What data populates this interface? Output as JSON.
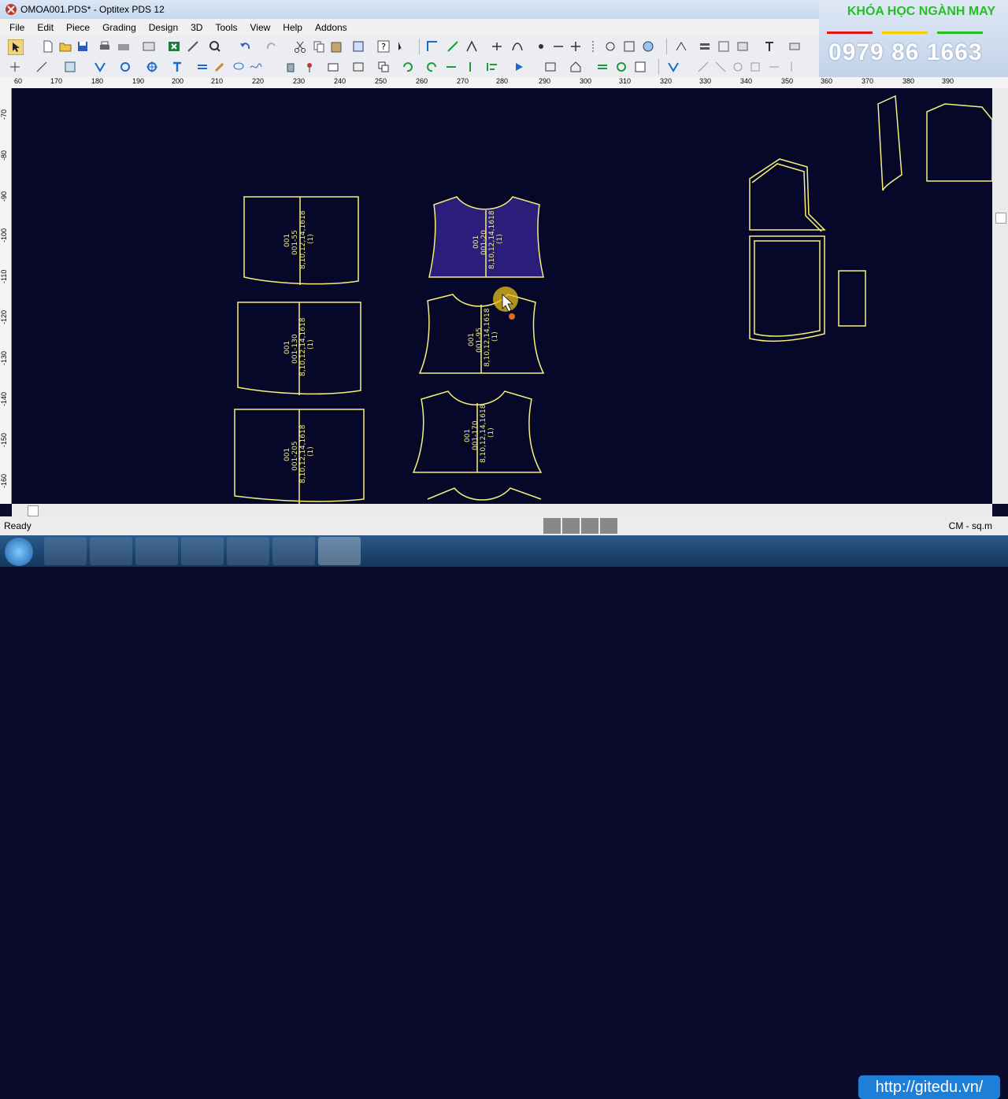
{
  "window": {
    "title": "OMOA001.PDS* - Optitex PDS 12"
  },
  "menu": [
    "File",
    "Edit",
    "Piece",
    "Grading",
    "Design",
    "3D",
    "Tools",
    "View",
    "Help",
    "Addons"
  ],
  "promo": {
    "course": "KHÓA HỌC NGÀNH MAY",
    "phone": "0979 86 1663",
    "colors": {
      "red": "#e01515",
      "yellow": "#f1d000",
      "green": "#1fbf1f"
    }
  },
  "ruler_h": [
    "60",
    "170",
    "180",
    "190",
    "200",
    "210",
    "220",
    "230",
    "240",
    "250",
    "260",
    "270",
    "280",
    "290",
    "300",
    "310",
    "320",
    "330",
    "340",
    "350",
    "360",
    "370",
    "380",
    "390"
  ],
  "ruler_v": [
    "-70",
    "-80",
    "-90",
    "-100",
    "-110",
    "-120",
    "-130",
    "-140",
    "-150",
    "-160"
  ],
  "pieces": [
    {
      "id": "rect-1",
      "label": "001\n001-55\n8,10,12,14,1618\n(1)"
    },
    {
      "id": "bodice-1",
      "label": "001\n001-20\n8,10,12,14,1618\n(1)"
    },
    {
      "id": "rect-2",
      "label": "001\n001-130\n8,10,12,14,1618\n(1)"
    },
    {
      "id": "bodice-2",
      "label": "001\n001-95\n8,10,12,14,1618\n(1)"
    },
    {
      "id": "rect-3",
      "label": "001\n001-205\n8,10,12,14,1618\n(1)"
    },
    {
      "id": "bodice-3",
      "label": "001\n001-170\n8,10,12,14,1618\n(1)"
    }
  ],
  "status": {
    "ready": "Ready",
    "units": "CM - sq.m"
  },
  "website": "http://gitedu.vn/",
  "colors": {
    "canvas": "#07072a",
    "piece_outline": "#f5f07a",
    "selected_fill": "#2a1e7a"
  }
}
